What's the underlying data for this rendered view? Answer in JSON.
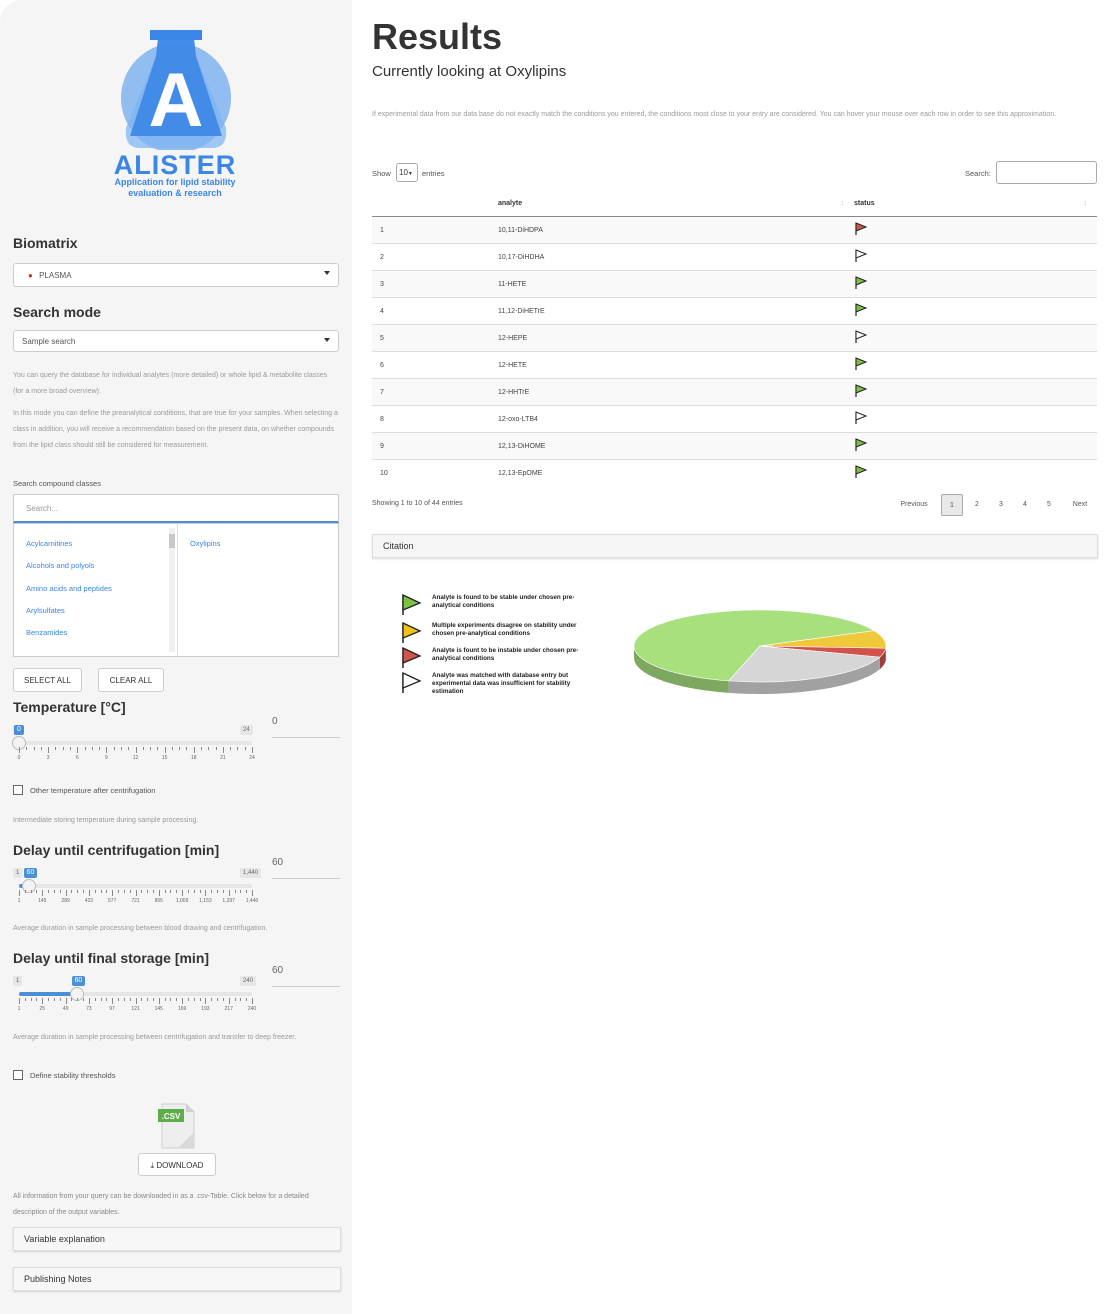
{
  "sidebar": {
    "logo": {
      "letter": "A",
      "title": "ALISTER",
      "subtitle": "Application for lipid stability evaluation & research",
      "color": "#3b86e6"
    },
    "biomatrix": {
      "label": "Biomatrix",
      "value": "PLASMA"
    },
    "search_mode": {
      "label": "Search mode",
      "value": "Sample search"
    },
    "help1": "You can query the database for individual analytes (more detailed) or whole lipid & metabolite classes (for a more broad overview).",
    "help2": "In this mode you can define the preanalytical conditions, that are true for your samples. When selecting a class in addition, you will receive a recommendation based on the present data, on whether compounds from the lipid class should still be considered for measurement.",
    "compound_classes": {
      "label": "Search compound classes",
      "placeholder": "Search...",
      "available": [
        "Acylcarnitines",
        "Alcohols and polyols",
        "Amino acids and peptides",
        "Arylsulfates",
        "Benzamides"
      ],
      "selected": [
        "Oxylipins"
      ]
    },
    "buttons": {
      "select_all": "SELECT ALL",
      "clear_all": "CLEAR ALL"
    },
    "temperature": {
      "label": "Temperature [°C]",
      "value": 0,
      "min": 0,
      "max": 24,
      "input": "0",
      "ticks": [
        "0",
        "3",
        "6",
        "9",
        "12",
        "15",
        "18",
        "21",
        "24"
      ]
    },
    "other_temp": {
      "label": "Other temperature after centrifugation",
      "checked": false
    },
    "help_temp": "Intermediate storing temperature during sample processing.",
    "delay_centrifugation": {
      "label": "Delay until centrifugation [min]",
      "value": 60,
      "min": 1,
      "max": 1440,
      "min_label": "1",
      "max_label": "1,440",
      "value_label": "60",
      "input": "60",
      "ticks": [
        "1",
        "145",
        "289",
        "433",
        "577",
        "721",
        "865",
        "1,009",
        "1,153",
        "1,297",
        "1,440"
      ]
    },
    "help_centrifugation": "Average duration in sample processing between blood drawing and centrifugation.",
    "delay_storage": {
      "label": "Delay until final storage [min]",
      "value": 60,
      "min": 1,
      "max": 240,
      "min_label": "1",
      "max_label": "240",
      "value_label": "60",
      "input": "60",
      "ticks": [
        "1",
        "25",
        "49",
        "73",
        "97",
        "121",
        "145",
        "169",
        "193",
        "217",
        "240"
      ]
    },
    "help_storage": "Average duration in sample processing between centrifugation and transfer to deep freezer.",
    "stability_thresholds": {
      "label": "Define stability thresholds",
      "checked": false
    },
    "csv_label": ".CSV",
    "download_label": "DOWNLOAD",
    "help_download": "All information from your query can be downloaded in as a .csv-Table. Click below for a detailed description of the output variables.",
    "panels": [
      "Variable explanation",
      "Publishing Notes"
    ]
  },
  "main": {
    "title": "Results",
    "subtitle": "Currently looking at Oxylipins",
    "intro": "If experimental data from our data base do not exactly match the conditions you entered, the conditions most close to your entry are considered. You can hover your mouse over each row in order to see this approximation.",
    "show_label": "Show",
    "entries_value": "10",
    "entries_label": "entries",
    "search_label": "Search:",
    "columns": [
      "analyte",
      "status"
    ],
    "rows": [
      {
        "n": "1",
        "analyte": "10,11-DiHDPA",
        "status": "unstable"
      },
      {
        "n": "2",
        "analyte": "10,17-DiHDHA",
        "status": "insufficient"
      },
      {
        "n": "3",
        "analyte": "11-HETE",
        "status": "stable"
      },
      {
        "n": "4",
        "analyte": "11,12-DiHETrE",
        "status": "stable"
      },
      {
        "n": "5",
        "analyte": "12-HEPE",
        "status": "insufficient"
      },
      {
        "n": "6",
        "analyte": "12-HETE",
        "status": "stable"
      },
      {
        "n": "7",
        "analyte": "12-HHTrE",
        "status": "stable"
      },
      {
        "n": "8",
        "analyte": "12-oxo-LTB4",
        "status": "insufficient"
      },
      {
        "n": "9",
        "analyte": "12,13-DiHOME",
        "status": "stable"
      },
      {
        "n": "10",
        "analyte": "12,13-EpOME",
        "status": "stable"
      }
    ],
    "info": "Showing 1 to 10 of 44 entries",
    "pagination": [
      "Previous",
      "1",
      "2",
      "3",
      "4",
      "5",
      "Next"
    ],
    "active_page": "1",
    "citation_label": "Citation",
    "legend": [
      {
        "status": "stable",
        "text": "Analyte is found to be stable under chosen pre-analytical conditions",
        "color": "#7cc242"
      },
      {
        "status": "disagree",
        "text": "Multiple experiments disagree on stability under chosen pre-analytical conditions",
        "color": "#f2c31b"
      },
      {
        "status": "unstable",
        "text": "Analyte is fount to be instable under chosen pre-analytical conditions",
        "color": "#d0534c"
      },
      {
        "status": "insufficient",
        "text": "Analyte was matched with database entry but experimental data was insufficient for stability estimation",
        "color": "#ffffff"
      }
    ]
  },
  "chart_data": {
    "type": "pie",
    "labels": [
      "stable",
      "disagree",
      "unstable",
      "insufficient"
    ],
    "values": [
      64,
      8,
      4,
      24
    ],
    "colors": [
      "#a8e07e",
      "#f0c93a",
      "#d0534c",
      "#d6d6d6"
    ]
  }
}
